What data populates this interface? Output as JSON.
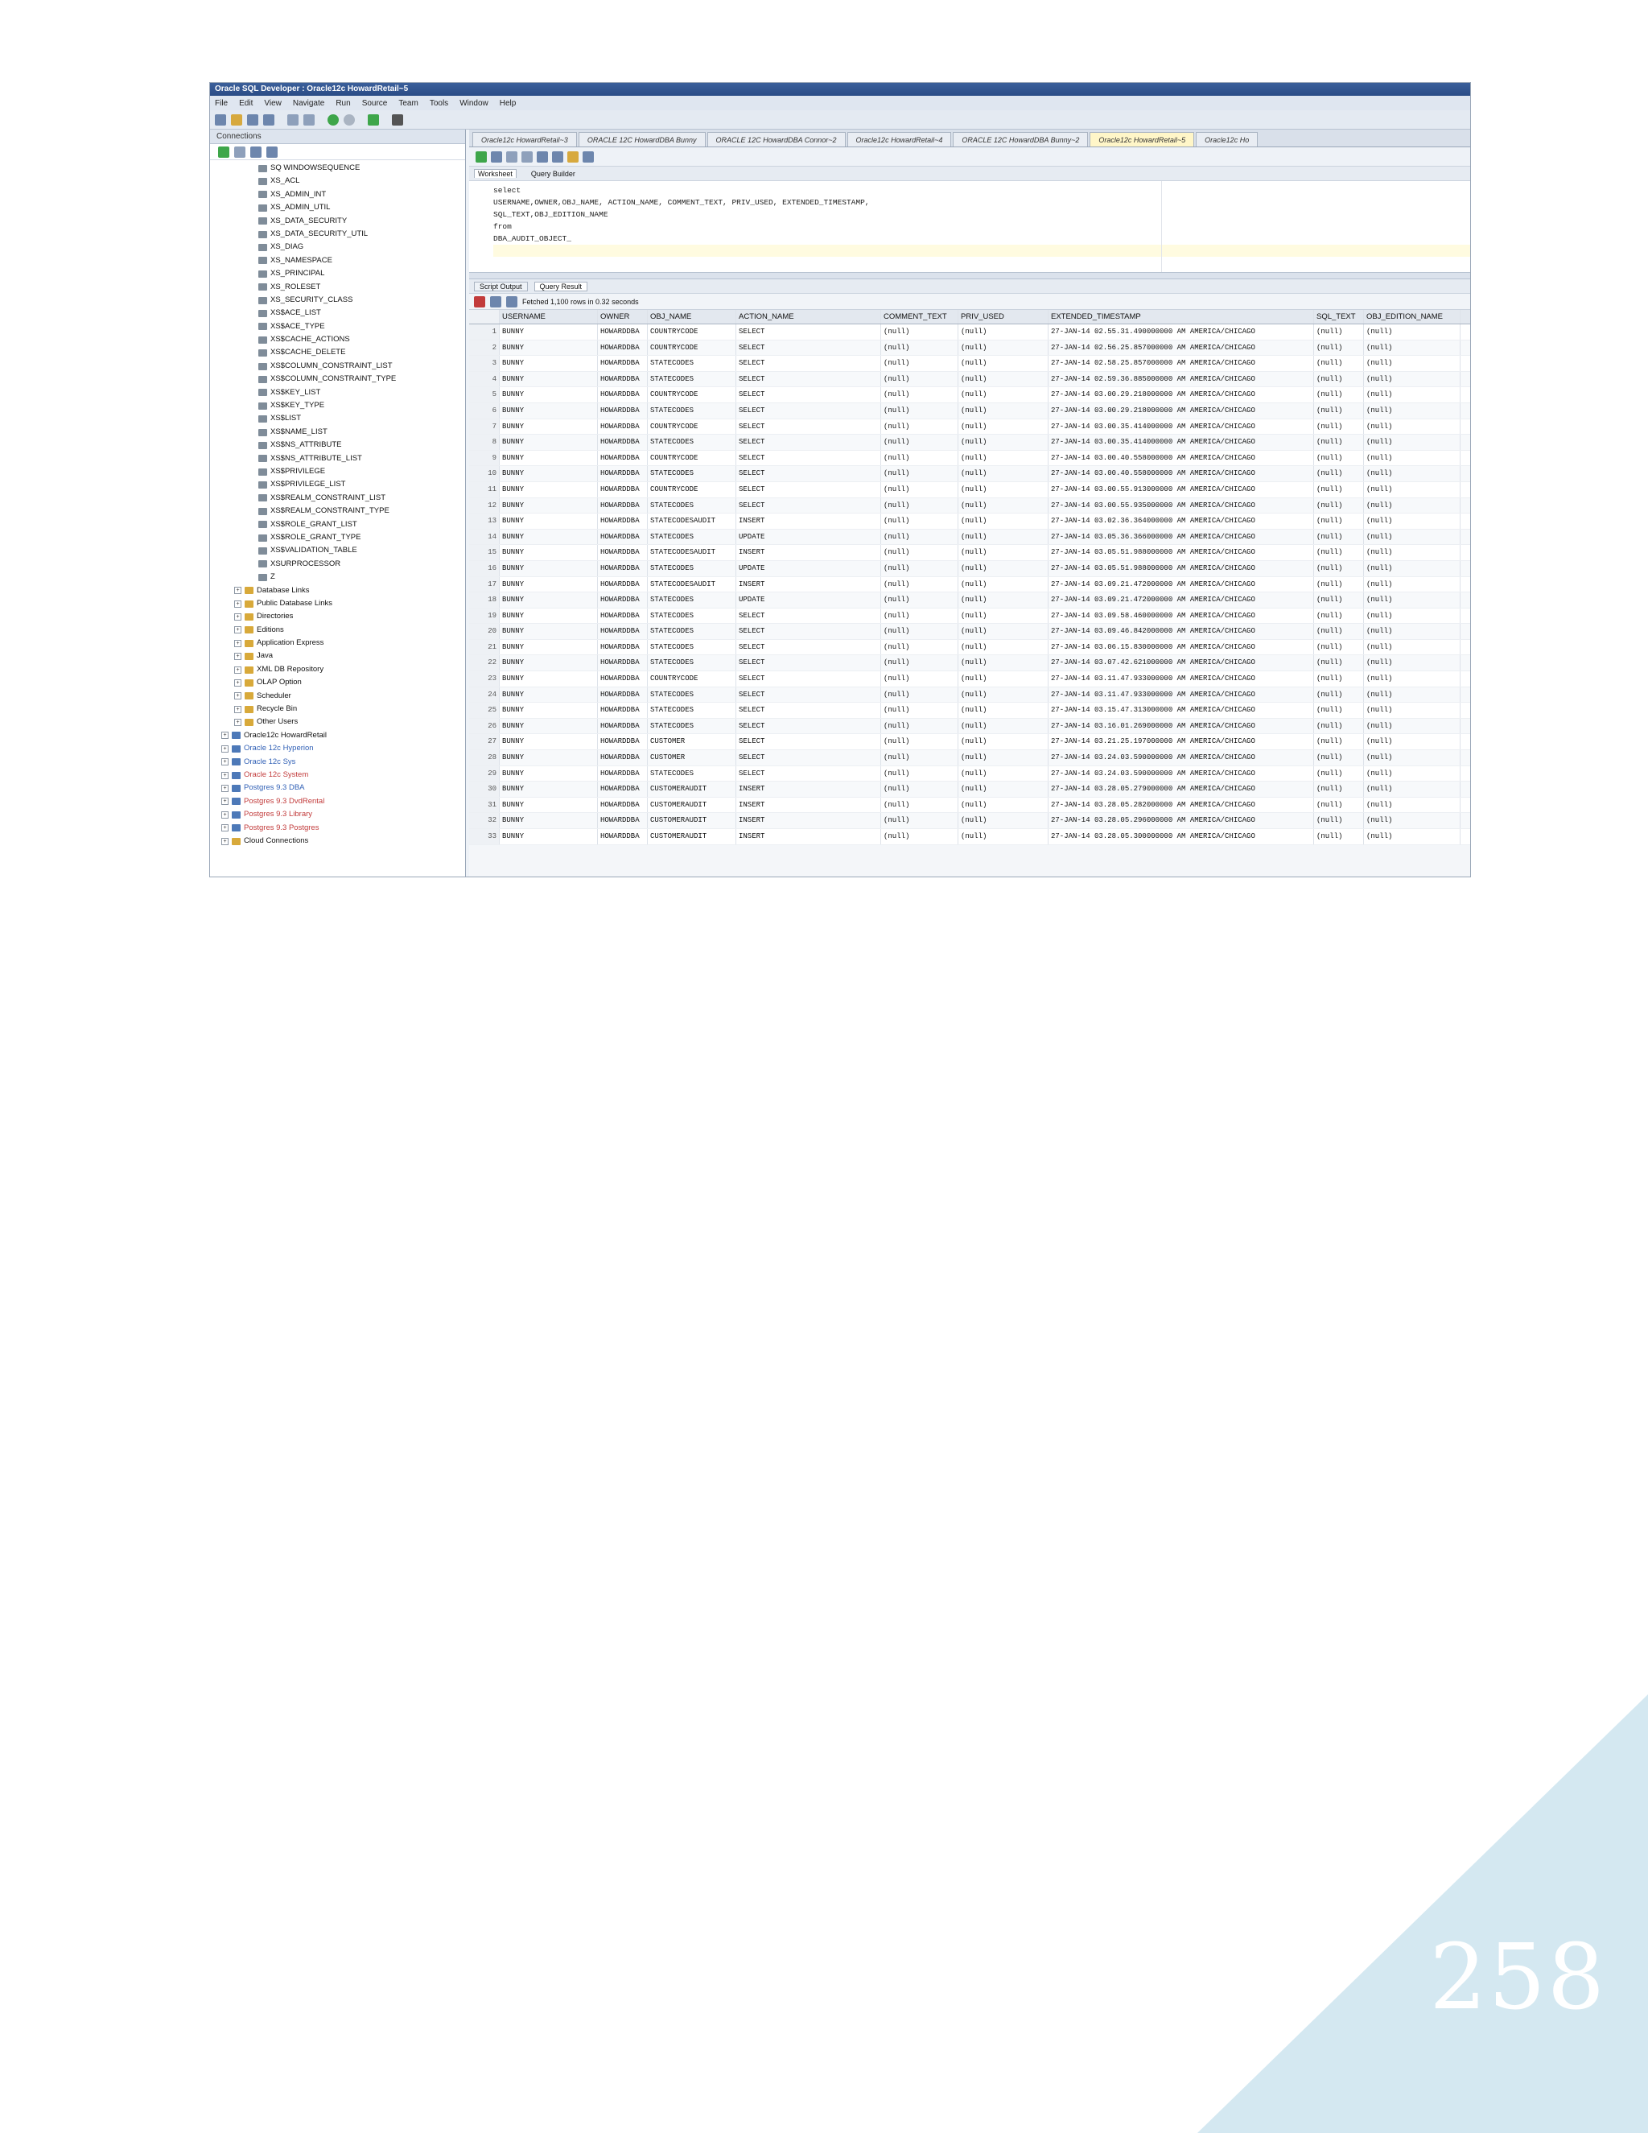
{
  "page": {
    "number": "258",
    "colors": {
      "corner_triangle": "#d4e8f1",
      "page_number": "#ffffff"
    }
  },
  "app": {
    "title": "Oracle SQL Developer : Oracle12c HowardRetail~5",
    "menu": [
      "File",
      "Edit",
      "View",
      "Navigate",
      "Run",
      "Source",
      "Team",
      "Tools",
      "Window",
      "Help"
    ]
  },
  "connections_panel": {
    "title": "Connections",
    "tree": [
      {
        "label": "SQ WINDOWSEQUENCE",
        "icon": "table-icon"
      },
      {
        "label": "XS_ACL",
        "icon": "table-icon"
      },
      {
        "label": "XS_ADMIN_INT",
        "icon": "table-icon"
      },
      {
        "label": "XS_ADMIN_UTIL",
        "icon": "table-icon"
      },
      {
        "label": "XS_DATA_SECURITY",
        "icon": "table-icon"
      },
      {
        "label": "XS_DATA_SECURITY_UTIL",
        "icon": "table-icon"
      },
      {
        "label": "XS_DIAG",
        "icon": "table-icon"
      },
      {
        "label": "XS_NAMESPACE",
        "icon": "table-icon"
      },
      {
        "label": "XS_PRINCIPAL",
        "icon": "table-icon"
      },
      {
        "label": "XS_ROLESET",
        "icon": "table-icon"
      },
      {
        "label": "XS_SECURITY_CLASS",
        "icon": "table-icon"
      },
      {
        "label": "XS$ACE_LIST",
        "icon": "table-icon"
      },
      {
        "label": "XS$ACE_TYPE",
        "icon": "table-icon"
      },
      {
        "label": "XS$CACHE_ACTIONS",
        "icon": "table-icon"
      },
      {
        "label": "XS$CACHE_DELETE",
        "icon": "table-icon"
      },
      {
        "label": "XS$COLUMN_CONSTRAINT_LIST",
        "icon": "table-icon"
      },
      {
        "label": "XS$COLUMN_CONSTRAINT_TYPE",
        "icon": "table-icon"
      },
      {
        "label": "XS$KEY_LIST",
        "icon": "table-icon"
      },
      {
        "label": "XS$KEY_TYPE",
        "icon": "table-icon"
      },
      {
        "label": "XS$LIST",
        "icon": "table-icon"
      },
      {
        "label": "XS$NAME_LIST",
        "icon": "table-icon"
      },
      {
        "label": "XS$NS_ATTRIBUTE",
        "icon": "table-icon"
      },
      {
        "label": "XS$NS_ATTRIBUTE_LIST",
        "icon": "table-icon"
      },
      {
        "label": "XS$PRIVILEGE",
        "icon": "table-icon"
      },
      {
        "label": "XS$PRIVILEGE_LIST",
        "icon": "table-icon"
      },
      {
        "label": "XS$REALM_CONSTRAINT_LIST",
        "icon": "table-icon"
      },
      {
        "label": "XS$REALM_CONSTRAINT_TYPE",
        "icon": "table-icon"
      },
      {
        "label": "XS$ROLE_GRANT_LIST",
        "icon": "table-icon"
      },
      {
        "label": "XS$ROLE_GRANT_TYPE",
        "icon": "table-icon"
      },
      {
        "label": "XS$VALIDATION_TABLE",
        "icon": "table-icon"
      },
      {
        "label": "XSURPROCESSOR",
        "icon": "table-icon"
      },
      {
        "label": "Z",
        "icon": "table-icon"
      },
      {
        "label": "Database Links",
        "icon": "folder-icon"
      },
      {
        "label": "Public Database Links",
        "icon": "folder-icon"
      },
      {
        "label": "Directories",
        "icon": "folder-icon"
      },
      {
        "label": "Editions",
        "icon": "folder-icon"
      },
      {
        "label": "Application Express",
        "icon": "folder-icon"
      },
      {
        "label": "Java",
        "icon": "folder-icon"
      },
      {
        "label": "XML DB Repository",
        "icon": "folder-icon"
      },
      {
        "label": "OLAP Option",
        "icon": "folder-icon"
      },
      {
        "label": "Scheduler",
        "icon": "folder-icon"
      },
      {
        "label": "Recycle Bin",
        "icon": "folder-icon"
      },
      {
        "label": "Other Users",
        "icon": "folder-icon"
      },
      {
        "label": "Oracle12c HowardRetail",
        "icon": "database-icon"
      },
      {
        "label": "Oracle 12c Hyperion",
        "icon": "database-icon"
      },
      {
        "label": "Oracle 12c Sys",
        "icon": "database-icon"
      },
      {
        "label": "Oracle 12c System",
        "icon": "database-icon"
      },
      {
        "label": "Postgres 9.3 DBA",
        "icon": "database-icon"
      },
      {
        "label": "Postgres 9.3 DvdRental",
        "icon": "database-icon"
      },
      {
        "label": "Postgres 9.3 Library",
        "icon": "database-icon"
      },
      {
        "label": "Postgres 9.3 Postgres",
        "icon": "database-icon"
      },
      {
        "label": "Cloud Connections",
        "icon": "folder-icon"
      }
    ],
    "colors": {
      "blue_item": "#2f5fb5",
      "red_item": "#c23b3b"
    }
  },
  "doc_tabs": [
    "Oracle12c HowardRetail~3",
    "ORACLE 12C HowardDBA Bunny",
    "ORACLE 12C HowardDBA Connor~2",
    "Oracle12c HowardRetail~4",
    "ORACLE 12C HowardDBA Bunny~2",
    "Oracle12c HowardRetail~5",
    "Oracle12c Ho"
  ],
  "worksheet": {
    "tabs": [
      "Worksheet",
      "Query Builder"
    ],
    "sql_lines": [
      "select",
      "USERNAME,OWNER,OBJ_NAME, ACTION_NAME, COMMENT_TEXT, PRIV_USED, EXTENDED_TIMESTAMP,",
      "SQL_TEXT,OBJ_EDITION_NAME",
      "from",
      "DBA_AUDIT_OBJECT_",
      ""
    ]
  },
  "results": {
    "tabs": [
      "Script Output",
      "Query Result"
    ],
    "status": "Fetched 1,100 rows in 0.32 seconds",
    "columns": [
      "",
      "USERNAME",
      "OWNER",
      "OBJ_NAME",
      "ACTION_NAME",
      "COMMENT_TEXT",
      "PRIV_USED",
      "EXTENDED_TIMESTAMP",
      "SQL_TEXT",
      "OBJ_EDITION_NAME"
    ],
    "rows": [
      [
        "1",
        "BUNNY",
        "HOWARDDBA",
        "COUNTRYCODE",
        "SELECT",
        "(null)",
        "(null)",
        "27-JAN-14 02.55.31.490000000 AM AMERICA/CHICAGO",
        "(null)",
        "(null)"
      ],
      [
        "2",
        "BUNNY",
        "HOWARDDBA",
        "COUNTRYCODE",
        "SELECT",
        "(null)",
        "(null)",
        "27-JAN-14 02.56.25.857000000 AM AMERICA/CHICAGO",
        "(null)",
        "(null)"
      ],
      [
        "3",
        "BUNNY",
        "HOWARDDBA",
        "STATECODES",
        "SELECT",
        "(null)",
        "(null)",
        "27-JAN-14 02.58.25.857000000 AM AMERICA/CHICAGO",
        "(null)",
        "(null)"
      ],
      [
        "4",
        "BUNNY",
        "HOWARDDBA",
        "STATECODES",
        "SELECT",
        "(null)",
        "(null)",
        "27-JAN-14 02.59.36.885000000 AM AMERICA/CHICAGO",
        "(null)",
        "(null)"
      ],
      [
        "5",
        "BUNNY",
        "HOWARDDBA",
        "COUNTRYCODE",
        "SELECT",
        "(null)",
        "(null)",
        "27-JAN-14 03.00.29.218000000 AM AMERICA/CHICAGO",
        "(null)",
        "(null)"
      ],
      [
        "6",
        "BUNNY",
        "HOWARDDBA",
        "STATECODES",
        "SELECT",
        "(null)",
        "(null)",
        "27-JAN-14 03.00.29.218000000 AM AMERICA/CHICAGO",
        "(null)",
        "(null)"
      ],
      [
        "7",
        "BUNNY",
        "HOWARDDBA",
        "COUNTRYCODE",
        "SELECT",
        "(null)",
        "(null)",
        "27-JAN-14 03.00.35.414000000 AM AMERICA/CHICAGO",
        "(null)",
        "(null)"
      ],
      [
        "8",
        "BUNNY",
        "HOWARDDBA",
        "STATECODES",
        "SELECT",
        "(null)",
        "(null)",
        "27-JAN-14 03.00.35.414000000 AM AMERICA/CHICAGO",
        "(null)",
        "(null)"
      ],
      [
        "9",
        "BUNNY",
        "HOWARDDBA",
        "COUNTRYCODE",
        "SELECT",
        "(null)",
        "(null)",
        "27-JAN-14 03.00.40.558000000 AM AMERICA/CHICAGO",
        "(null)",
        "(null)"
      ],
      [
        "10",
        "BUNNY",
        "HOWARDDBA",
        "STATECODES",
        "SELECT",
        "(null)",
        "(null)",
        "27-JAN-14 03.00.40.558000000 AM AMERICA/CHICAGO",
        "(null)",
        "(null)"
      ],
      [
        "11",
        "BUNNY",
        "HOWARDDBA",
        "COUNTRYCODE",
        "SELECT",
        "(null)",
        "(null)",
        "27-JAN-14 03.00.55.913000000 AM AMERICA/CHICAGO",
        "(null)",
        "(null)"
      ],
      [
        "12",
        "BUNNY",
        "HOWARDDBA",
        "STATECODES",
        "SELECT",
        "(null)",
        "(null)",
        "27-JAN-14 03.00.55.935000000 AM AMERICA/CHICAGO",
        "(null)",
        "(null)"
      ],
      [
        "13",
        "BUNNY",
        "HOWARDDBA",
        "STATECODESAUDIT",
        "INSERT",
        "(null)",
        "(null)",
        "27-JAN-14 03.02.36.364000000 AM AMERICA/CHICAGO",
        "(null)",
        "(null)"
      ],
      [
        "14",
        "BUNNY",
        "HOWARDDBA",
        "STATECODES",
        "UPDATE",
        "(null)",
        "(null)",
        "27-JAN-14 03.05.36.366000000 AM AMERICA/CHICAGO",
        "(null)",
        "(null)"
      ],
      [
        "15",
        "BUNNY",
        "HOWARDDBA",
        "STATECODESAUDIT",
        "INSERT",
        "(null)",
        "(null)",
        "27-JAN-14 03.05.51.988000000 AM AMERICA/CHICAGO",
        "(null)",
        "(null)"
      ],
      [
        "16",
        "BUNNY",
        "HOWARDDBA",
        "STATECODES",
        "UPDATE",
        "(null)",
        "(null)",
        "27-JAN-14 03.05.51.988000000 AM AMERICA/CHICAGO",
        "(null)",
        "(null)"
      ],
      [
        "17",
        "BUNNY",
        "HOWARDDBA",
        "STATECODESAUDIT",
        "INSERT",
        "(null)",
        "(null)",
        "27-JAN-14 03.09.21.472000000 AM AMERICA/CHICAGO",
        "(null)",
        "(null)"
      ],
      [
        "18",
        "BUNNY",
        "HOWARDDBA",
        "STATECODES",
        "UPDATE",
        "(null)",
        "(null)",
        "27-JAN-14 03.09.21.472000000 AM AMERICA/CHICAGO",
        "(null)",
        "(null)"
      ],
      [
        "19",
        "BUNNY",
        "HOWARDDBA",
        "STATECODES",
        "SELECT",
        "(null)",
        "(null)",
        "27-JAN-14 03.09.58.460000000 AM AMERICA/CHICAGO",
        "(null)",
        "(null)"
      ],
      [
        "20",
        "BUNNY",
        "HOWARDDBA",
        "STATECODES",
        "SELECT",
        "(null)",
        "(null)",
        "27-JAN-14 03.09.46.842000000 AM AMERICA/CHICAGO",
        "(null)",
        "(null)"
      ],
      [
        "21",
        "BUNNY",
        "HOWARDDBA",
        "STATECODES",
        "SELECT",
        "(null)",
        "(null)",
        "27-JAN-14 03.06.15.830000000 AM AMERICA/CHICAGO",
        "(null)",
        "(null)"
      ],
      [
        "22",
        "BUNNY",
        "HOWARDDBA",
        "STATECODES",
        "SELECT",
        "(null)",
        "(null)",
        "27-JAN-14 03.07.42.621000000 AM AMERICA/CHICAGO",
        "(null)",
        "(null)"
      ],
      [
        "23",
        "BUNNY",
        "HOWARDDBA",
        "COUNTRYCODE",
        "SELECT",
        "(null)",
        "(null)",
        "27-JAN-14 03.11.47.933000000 AM AMERICA/CHICAGO",
        "(null)",
        "(null)"
      ],
      [
        "24",
        "BUNNY",
        "HOWARDDBA",
        "STATECODES",
        "SELECT",
        "(null)",
        "(null)",
        "27-JAN-14 03.11.47.933000000 AM AMERICA/CHICAGO",
        "(null)",
        "(null)"
      ],
      [
        "25",
        "BUNNY",
        "HOWARDDBA",
        "STATECODES",
        "SELECT",
        "(null)",
        "(null)",
        "27-JAN-14 03.15.47.313000000 AM AMERICA/CHICAGO",
        "(null)",
        "(null)"
      ],
      [
        "26",
        "BUNNY",
        "HOWARDDBA",
        "STATECODES",
        "SELECT",
        "(null)",
        "(null)",
        "27-JAN-14 03.16.01.269000000 AM AMERICA/CHICAGO",
        "(null)",
        "(null)"
      ],
      [
        "27",
        "BUNNY",
        "HOWARDDBA",
        "CUSTOMER",
        "SELECT",
        "(null)",
        "(null)",
        "27-JAN-14 03.21.25.197000000 AM AMERICA/CHICAGO",
        "(null)",
        "(null)"
      ],
      [
        "28",
        "BUNNY",
        "HOWARDDBA",
        "CUSTOMER",
        "SELECT",
        "(null)",
        "(null)",
        "27-JAN-14 03.24.03.590000000 AM AMERICA/CHICAGO",
        "(null)",
        "(null)"
      ],
      [
        "29",
        "BUNNY",
        "HOWARDDBA",
        "STATECODES",
        "SELECT",
        "(null)",
        "(null)",
        "27-JAN-14 03.24.03.590000000 AM AMERICA/CHICAGO",
        "(null)",
        "(null)"
      ],
      [
        "30",
        "BUNNY",
        "HOWARDDBA",
        "CUSTOMERAUDIT",
        "INSERT",
        "(null)",
        "(null)",
        "27-JAN-14 03.28.05.279000000 AM AMERICA/CHICAGO",
        "(null)",
        "(null)"
      ],
      [
        "31",
        "BUNNY",
        "HOWARDDBA",
        "CUSTOMERAUDIT",
        "INSERT",
        "(null)",
        "(null)",
        "27-JAN-14 03.28.05.282000000 AM AMERICA/CHICAGO",
        "(null)",
        "(null)"
      ],
      [
        "32",
        "BUNNY",
        "HOWARDDBA",
        "CUSTOMERAUDIT",
        "INSERT",
        "(null)",
        "(null)",
        "27-JAN-14 03.28.05.296000000 AM AMERICA/CHICAGO",
        "(null)",
        "(null)"
      ],
      [
        "33",
        "BUNNY",
        "HOWARDDBA",
        "CUSTOMERAUDIT",
        "INSERT",
        "(null)",
        "(null)",
        "27-JAN-14 03.28.05.300000000 AM AMERICA/CHICAGO",
        "(null)",
        "(null)"
      ]
    ]
  }
}
